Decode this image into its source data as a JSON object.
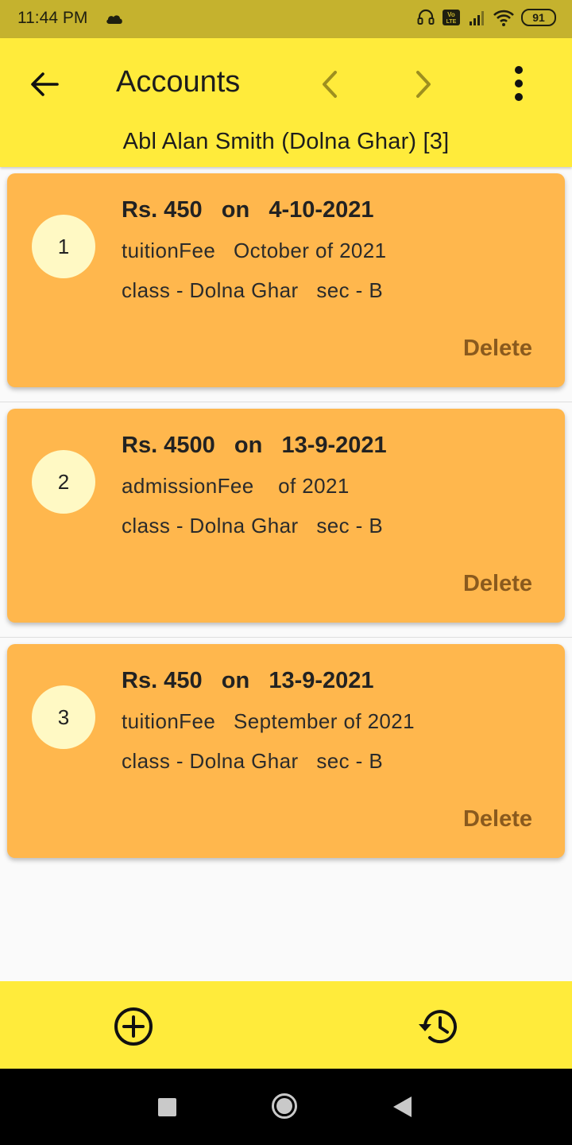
{
  "status_bar": {
    "time": "11:44 PM",
    "battery": "91",
    "icons": [
      "cloud-icon",
      "headset-icon",
      "volte-icon",
      "signal-icon",
      "wifi-icon",
      "battery-icon"
    ]
  },
  "app_bar": {
    "title": "Accounts",
    "subtitle": "Abl Alan Smith  (Dolna Ghar)  [3]",
    "icons": [
      "back-arrow-icon",
      "chevron-left-icon",
      "chevron-right-icon",
      "more-vert-icon"
    ]
  },
  "entries": [
    {
      "index": "1",
      "line1": "Rs. 450   on   4-10-2021",
      "line2": "tuitionFee   October of 2021",
      "line3": "class - Dolna Ghar   sec - B",
      "delete_label": "Delete"
    },
    {
      "index": "2",
      "line1": "Rs. 4500   on   13-9-2021",
      "line2": "admissionFee    of 2021",
      "line3": "class - Dolna Ghar   sec - B",
      "delete_label": "Delete"
    },
    {
      "index": "3",
      "line1": "Rs. 450   on   13-9-2021",
      "line2": "tuitionFee   September of 2021",
      "line3": "class - Dolna Ghar   sec - B",
      "delete_label": "Delete"
    }
  ],
  "bottom_bar": {
    "icons": [
      "add-circle-icon",
      "history-icon"
    ]
  },
  "colors": {
    "status_bar": "#c5b22e",
    "app_bar": "#ffeb3b",
    "card": "#ffb74d",
    "avatar": "#fff9c4",
    "delete_text": "#8a5a1e",
    "chevron": "#9e8f1f"
  }
}
